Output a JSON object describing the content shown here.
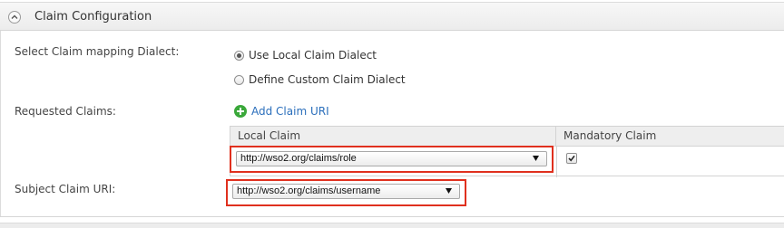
{
  "panel": {
    "title": "Claim Configuration",
    "collapse_icon": "chevron-up-icon"
  },
  "dialect": {
    "label": "Select Claim mapping Dialect:",
    "options": [
      {
        "label": "Use Local Claim Dialect",
        "checked": true
      },
      {
        "label": "Define Custom Claim Dialect",
        "checked": false
      }
    ]
  },
  "requested_claims": {
    "label": "Requested Claims:",
    "add_label": "Add Claim URI",
    "add_icon": "plus-circle-icon",
    "columns": [
      "Local Claim",
      "Mandatory Claim"
    ],
    "rows": [
      {
        "local_claim": "http://wso2.org/claims/role",
        "mandatory": true
      }
    ]
  },
  "subject_claim": {
    "label": "Subject Claim URI:",
    "value": "http://wso2.org/claims/username"
  },
  "colors": {
    "highlight": "#e0301e",
    "link": "#2a6ebb",
    "add_icon": "#3aa83a"
  }
}
